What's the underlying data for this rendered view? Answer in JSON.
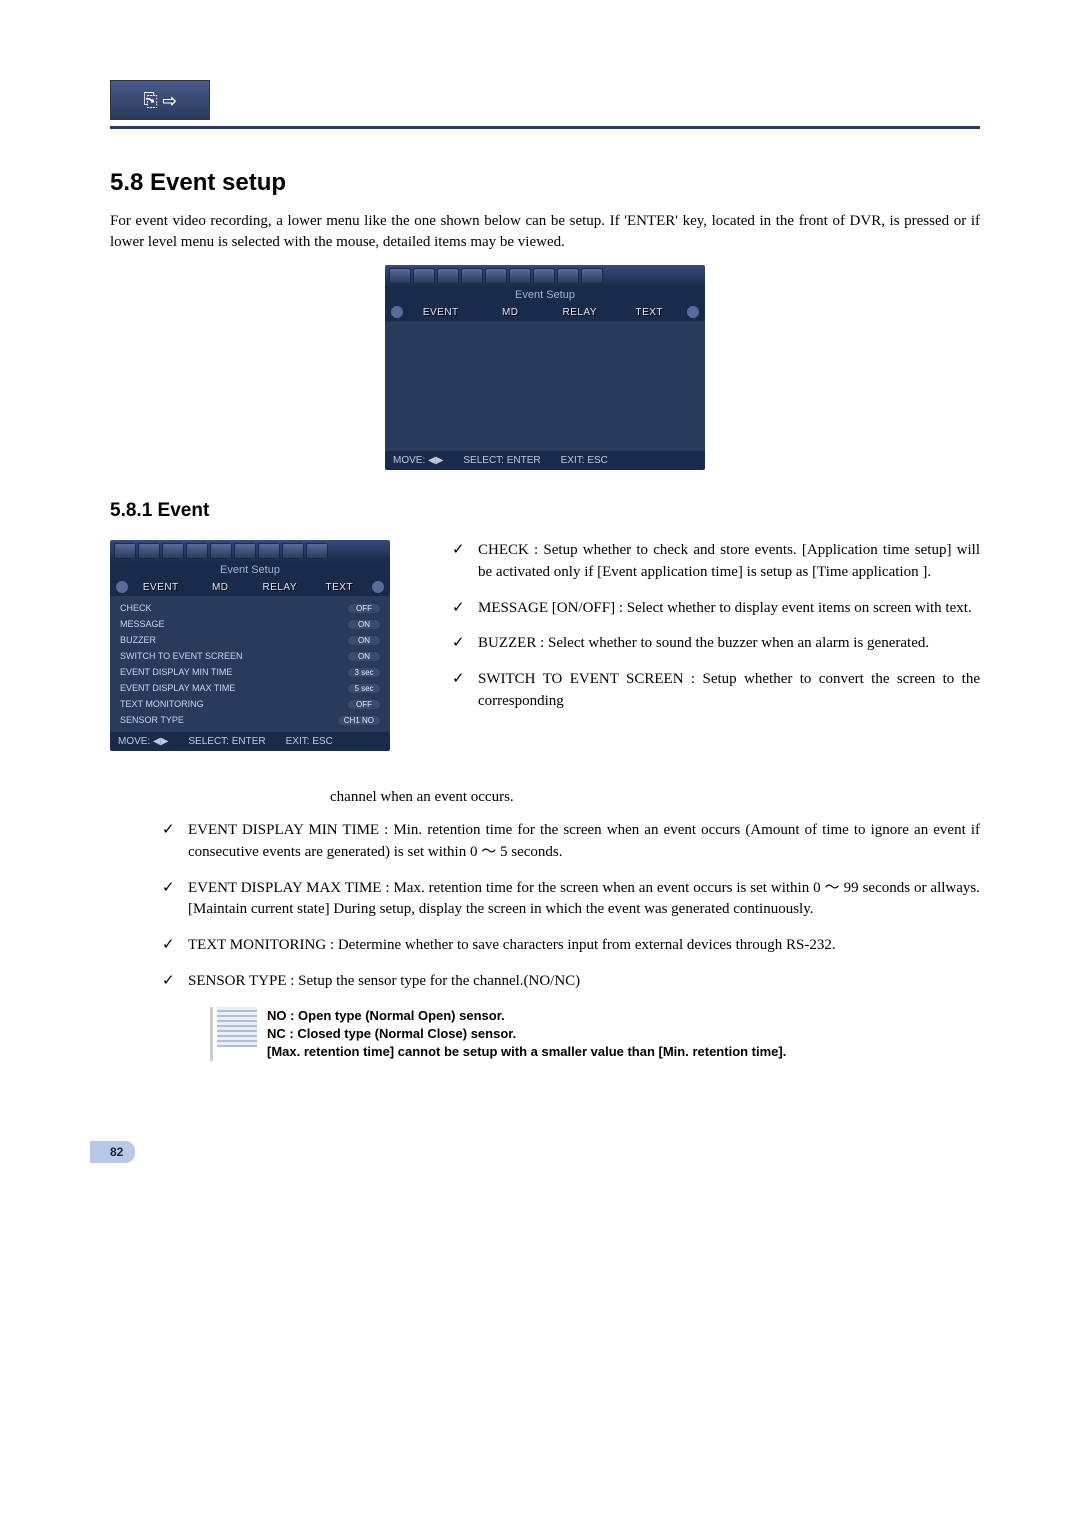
{
  "icons": {
    "header": "⎘ ⇨"
  },
  "section": {
    "title": "5.8 Event setup",
    "intro": "For event video recording, a lower menu like the one shown below can be setup. If 'ENTER' key, located in the front of DVR, is pressed or if lower level menu is selected with the mouse, detailed items may be viewed."
  },
  "screenshot1": {
    "title": "Event Setup",
    "tabs": [
      "EVENT",
      "MD",
      "RELAY",
      "TEXT"
    ],
    "footer_move": "MOVE: ◀▶",
    "footer_select": "SELECT: ENTER",
    "footer_exit": "EXIT: ESC"
  },
  "subsection": {
    "title": "5.8.1 Event"
  },
  "screenshot2": {
    "title": "Event Setup",
    "tabs": [
      "EVENT",
      "MD",
      "RELAY",
      "TEXT"
    ],
    "rows": [
      {
        "label": "CHECK",
        "value": "OFF"
      },
      {
        "label": "MESSAGE",
        "value": "ON"
      },
      {
        "label": "BUZZER",
        "value": "ON"
      },
      {
        "label": "SWITCH TO EVENT SCREEN",
        "value": "ON"
      },
      {
        "label": "EVENT DISPLAY MIN TIME",
        "value": "3 sec"
      },
      {
        "label": "EVENT DISPLAY MAX TIME",
        "value": "5 sec"
      },
      {
        "label": "TEXT MONITORING",
        "value": "OFF"
      },
      {
        "label": "SENSOR TYPE",
        "value": "CH1  NO"
      }
    ],
    "footer_move": "MOVE: ◀▶",
    "footer_select": "SELECT: ENTER",
    "footer_exit": "EXIT: ESC"
  },
  "right_bullets": [
    "CHECK : Setup whether to check and store events. [Application time setup] will be activated only if [Event application time] is setup as [Time application ].",
    "MESSAGE [ON/OFF] : Select whether to display event items on screen with text.",
    "BUZZER : Select whether to sound the buzzer when an alarm is generated.",
    "SWITCH TO EVENT SCREEN : Setup whether to convert the screen to the corresponding"
  ],
  "wrap_tail": "channel when an event occurs.",
  "full_bullets": [
    "EVENT DISPLAY MIN TIME : Min. retention time for the screen when an event occurs (Amount of time to ignore an event if consecutive events are generated) is set within 0 ～ 5 seconds.",
    "EVENT DISPLAY MAX TIME : Max. retention time for the screen when an event occurs is set within 0 ～ 99 seconds or allways. [Maintain current state] During setup, display the screen in which the event was generated continuously.",
    "TEXT MONITORING : Determine whether to save characters input from external devices through RS-232.",
    "SENSOR TYPE : Setup the sensor type for the channel.(NO/NC)"
  ],
  "note": {
    "line1": "NO : Open type (Normal Open) sensor.",
    "line2": "NC : Closed type (Normal Close) sensor.",
    "line3": "[Max. retention time] cannot be setup with a smaller value than [Min. retention time]."
  },
  "page_number": "82"
}
